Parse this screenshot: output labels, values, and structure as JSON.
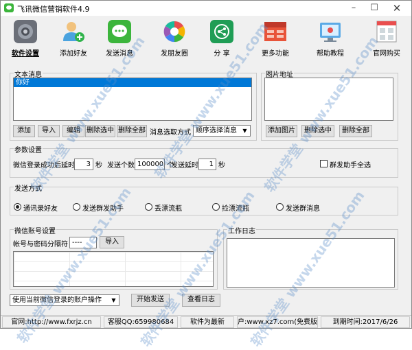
{
  "window": {
    "title": "飞讯微信营销软件4.9"
  },
  "toolbar": {
    "items": [
      {
        "label": "软件设置",
        "icon": "gear-icon"
      },
      {
        "label": "添加好友",
        "icon": "add-user-icon"
      },
      {
        "label": "发送消息",
        "icon": "chat-icon"
      },
      {
        "label": "发朋友圈",
        "icon": "moments-icon"
      },
      {
        "label": "分  享",
        "icon": "share-icon"
      },
      {
        "label": "更多功能",
        "icon": "more-icon"
      },
      {
        "label": "帮助教程",
        "icon": "help-icon"
      },
      {
        "label": "官网购买",
        "icon": "cart-icon"
      }
    ]
  },
  "text_msg": {
    "title": "文本消息",
    "items": [
      "你好"
    ],
    "buttons": {
      "add": "添加",
      "import": "导入",
      "edit": "编辑",
      "delete_selected": "删除选中",
      "delete_all": "删除全部"
    },
    "pick_label": "消息选取方式",
    "pick_value": "顺序选择消息"
  },
  "image_addr": {
    "title": "图片地址",
    "buttons": {
      "add": "添加图片",
      "delete_selected": "删除选中",
      "delete_all": "删除全部"
    }
  },
  "params": {
    "title": "参数设置",
    "login_delay_label": "微信登录成功后延时",
    "login_delay_value": "3",
    "sec1": "秒",
    "count_label": "发送个数",
    "count_value": "100000",
    "unit": "个",
    "send_delay_label": "发送延时",
    "send_delay_value": "1",
    "sec2": "秒",
    "select_all_label": "群发助手全选"
  },
  "send_mode": {
    "title": "发送方式",
    "options": [
      "通讯录好友",
      "发送群发助手",
      "丢漂流瓶",
      "捡漂流瓶",
      "发送群消息"
    ],
    "selected_index": 0
  },
  "account": {
    "title": "微信账号设置",
    "sep_label": "帐号与密码分隔符",
    "sep_value": "----",
    "import": "导入"
  },
  "log": {
    "title": "工作日志"
  },
  "actions": {
    "account_mode": "使用当前微信登录的账户操作",
    "start": "开始发送",
    "view_log": "查看日志"
  },
  "statusbar": {
    "site": "官网:http://www.fxrjz.cn",
    "qq": "客服QQ:659980684",
    "version": "软件为最新",
    "user": "户:www.xz7.com(免费版",
    "expire": "到期时间:2017/6/26"
  },
  "watermark": {
    "text": "软件学堂 www.xue51.com"
  },
  "colors": {
    "selection": "#0078d7",
    "chat": "#3cb53c",
    "share": "#1f9d55",
    "more": "#e8543a"
  }
}
